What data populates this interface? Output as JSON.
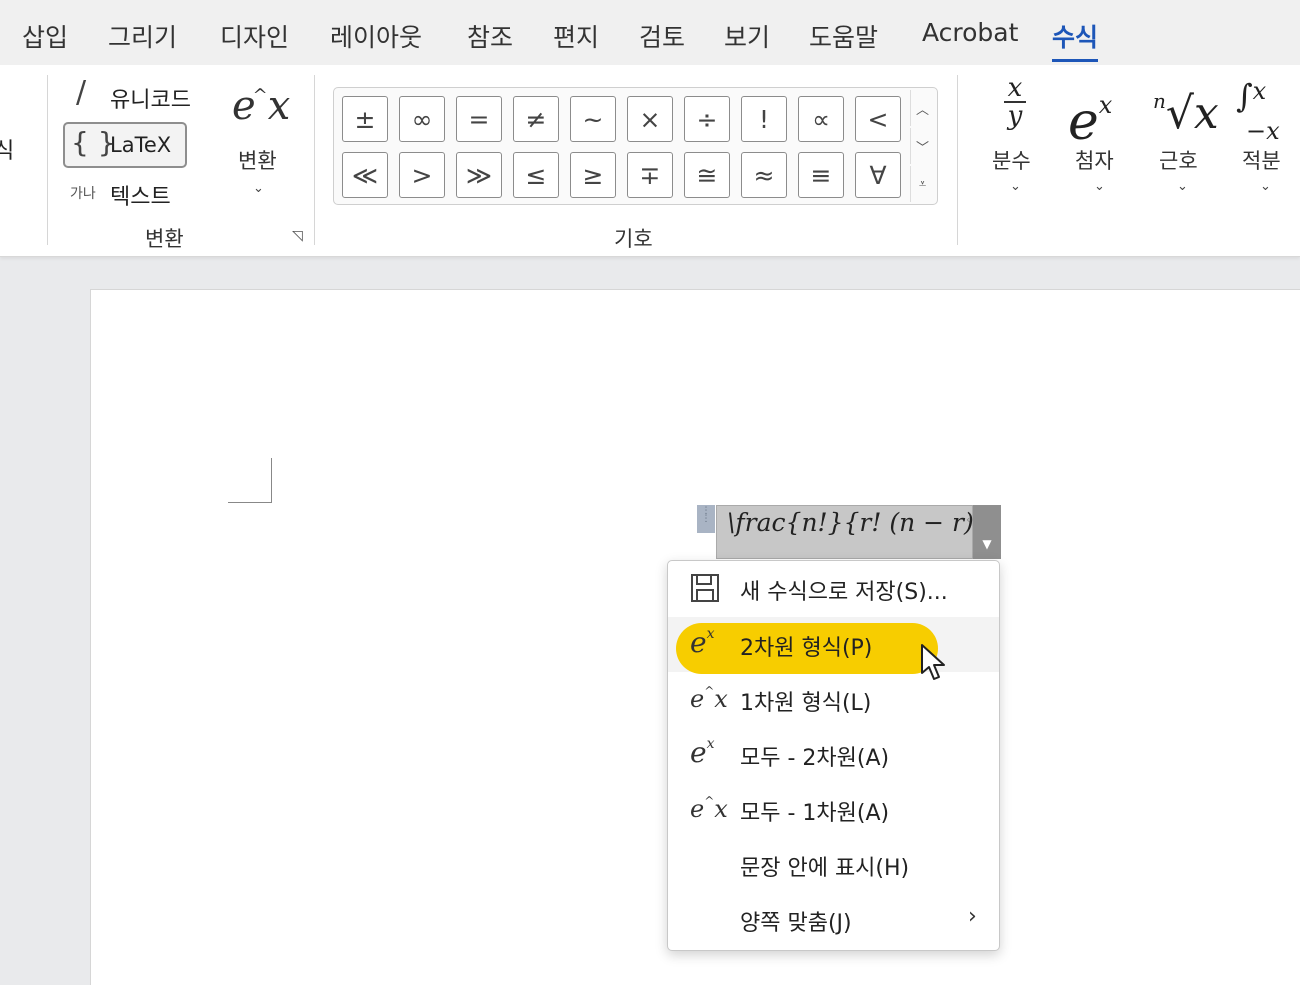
{
  "menu_tabs": [
    {
      "label": "삽입"
    },
    {
      "label": "그리기"
    },
    {
      "label": "디자인"
    },
    {
      "label": "레이아웃"
    },
    {
      "label": "참조"
    },
    {
      "label": "편지"
    },
    {
      "label": "검토"
    },
    {
      "label": "보기"
    },
    {
      "label": "도움말"
    },
    {
      "label": "Acrobat"
    },
    {
      "label": "수식"
    }
  ],
  "ribbon": {
    "left_cut_label": "식",
    "convert_group": {
      "unicode_label": "유니코드",
      "latex_label": "LaTeX",
      "text_prefix": "가나",
      "text_label": "텍스트",
      "convert_button_label": "변환",
      "group_label": "변환"
    },
    "symbols_group": {
      "row1": [
        "±",
        "∞",
        "=",
        "≠",
        "~",
        "×",
        "÷",
        "!",
        "∝",
        "<"
      ],
      "row2": [
        "≪",
        ">",
        "≫",
        "≤",
        "≥",
        "∓",
        "≅",
        "≈",
        "≡",
        "∀"
      ],
      "group_label": "기호"
    },
    "structures": [
      {
        "label": "분수"
      },
      {
        "label": "첨자"
      },
      {
        "label": "근호"
      },
      {
        "label": "적분"
      }
    ]
  },
  "equation": {
    "text": "\\frac{n!}{r! (n − r)!}"
  },
  "context_menu": {
    "items": [
      {
        "label": "새 수식으로 저장(S)...",
        "icon": "save-icon"
      },
      {
        "label": "2차원 형식(P)",
        "icon": "professional-format-icon"
      },
      {
        "label": "1차원 형식(L)",
        "icon": "linear-format-icon"
      },
      {
        "label": "모두 - 2차원(A)",
        "icon": "professional-format-icon"
      },
      {
        "label": "모두 - 1차원(A)",
        "icon": "linear-format-icon"
      },
      {
        "label": "문장 안에 표시(H)",
        "icon": ""
      },
      {
        "label": "양쪽 맞춤(J)",
        "icon": "chevron-right-icon"
      }
    ],
    "highlight_color": "#f7cd00"
  }
}
